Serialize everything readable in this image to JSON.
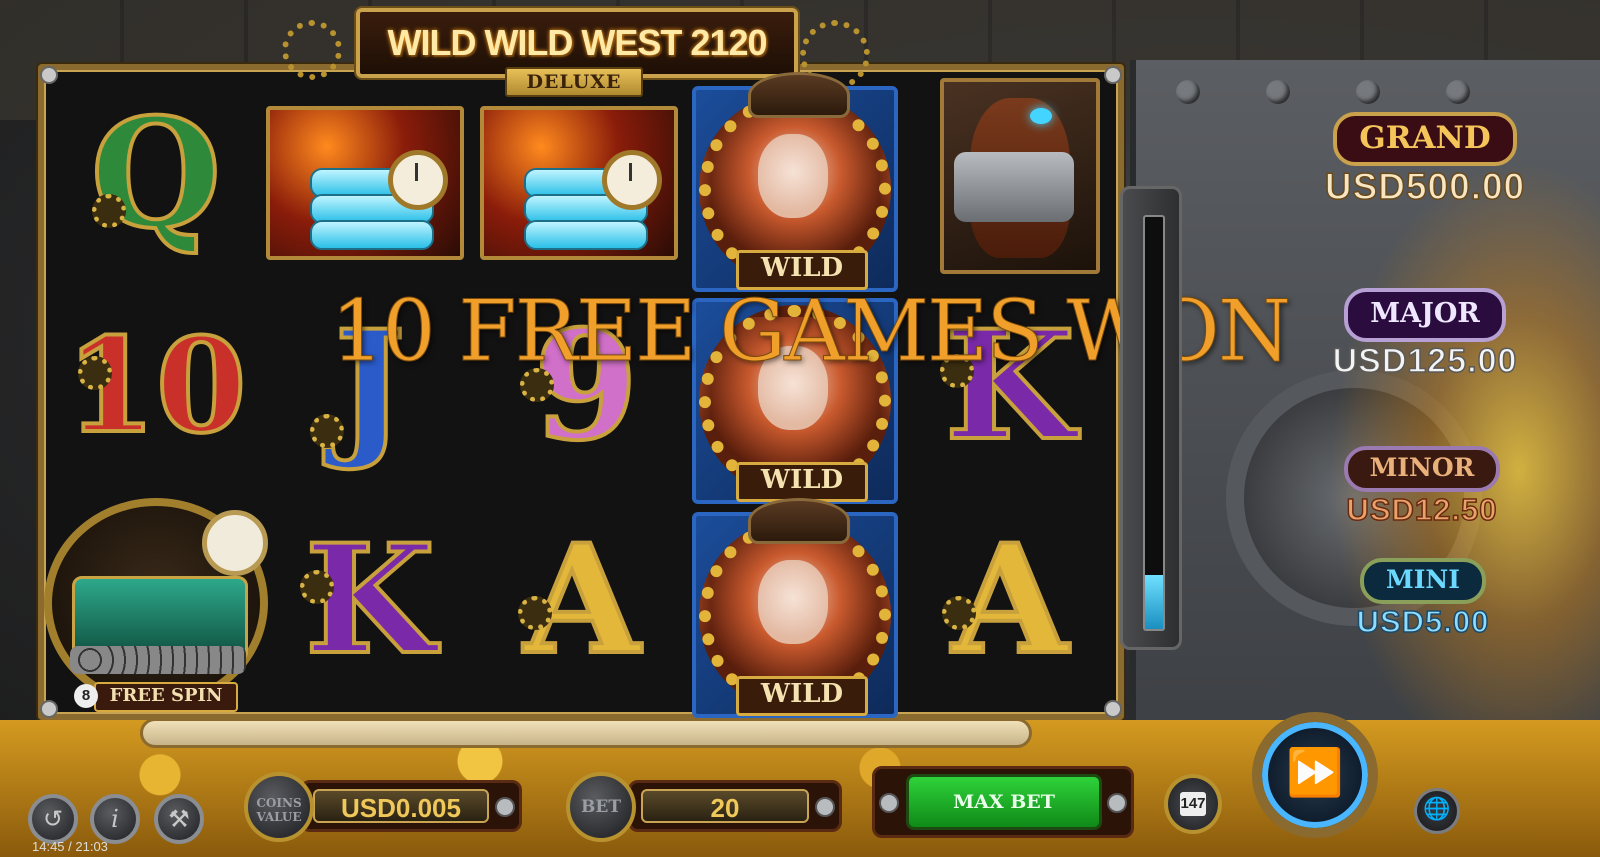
{
  "game": {
    "title": "WILD WILD WEST 2120",
    "subtitle": "DELUXE"
  },
  "reels": {
    "row1": [
      "Q",
      "dynamite",
      "dynamite",
      "WILD",
      "horse"
    ],
    "row2": [
      "10",
      "J",
      "9",
      "WILD",
      "K"
    ],
    "row3": [
      "train",
      "K",
      "A",
      "WILD",
      "A"
    ],
    "wild_label": "WILD",
    "letter_colors": {
      "Q": "#2e8a3a",
      "10": "#c9302a",
      "J": "#2a5bc9",
      "9": "#d070c8",
      "K": "#7a2aa8",
      "A": "#e2b73a"
    }
  },
  "free_spin_symbol": {
    "label": "FREE SPIN",
    "count": "8"
  },
  "announcement": "10 FREE GAMES WON",
  "meter": {
    "fill_fraction": 0.13
  },
  "jackpots": {
    "grand": {
      "label": "GRAND",
      "value": "USD500.00"
    },
    "major": {
      "label": "MAJOR",
      "value": "USD125.00"
    },
    "minor": {
      "label": "MINOR",
      "value": "USD12.50"
    },
    "mini": {
      "label": "MINI",
      "value": "USD5.00"
    }
  },
  "controls": {
    "history_icon": "history-icon",
    "info_icon": "info-icon",
    "info_glyph": "i",
    "settings_icon": "wrench-icon",
    "coins_value_label": "COINS VALUE",
    "coins_value": "USD0.005",
    "bet_label": "BET",
    "bet_value": "20",
    "max_bet_label": "MAX BET",
    "autoplay_count": "147",
    "spin_icon": "fast-forward-icon",
    "language_icon": "globe-icon"
  },
  "status": {
    "time": "14:45 / 21:03"
  },
  "colors": {
    "gold": "#caa24c",
    "announcement": "#f0a02a",
    "max_bet_green": "#2fd23a",
    "wild_blue": "#2a66c2"
  }
}
